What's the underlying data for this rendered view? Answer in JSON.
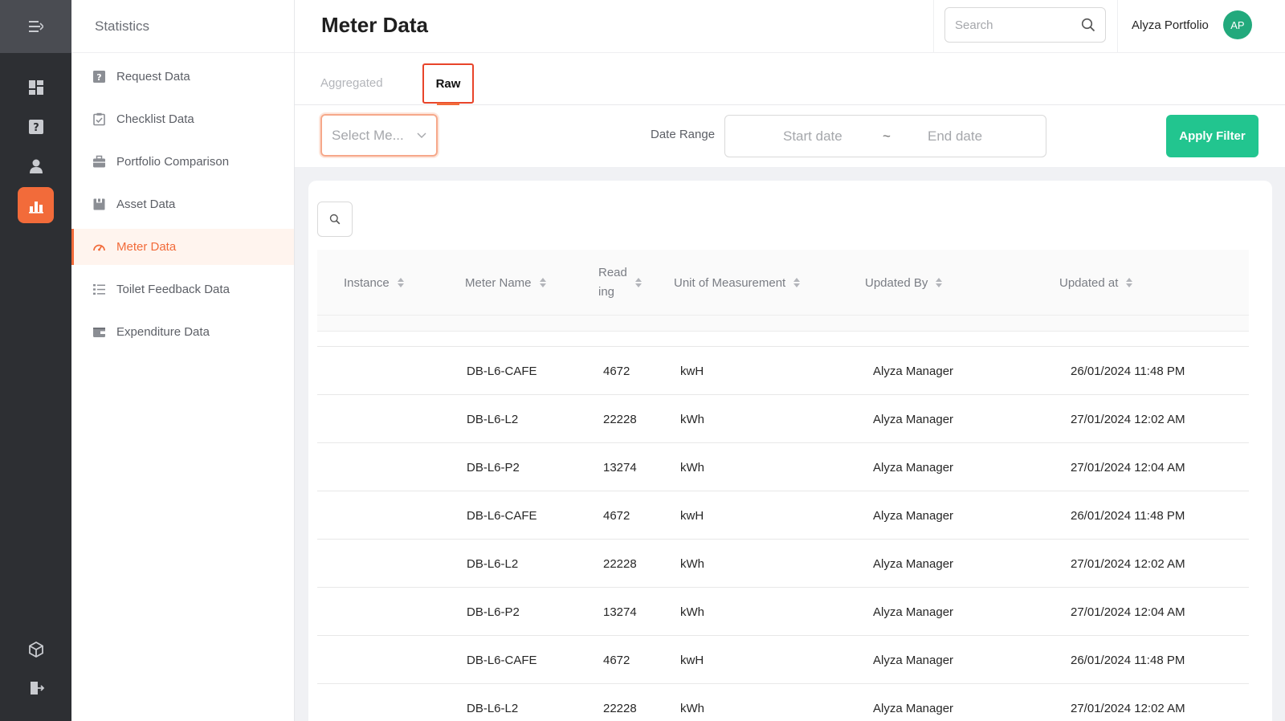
{
  "header": {
    "page_title": "Meter Data",
    "search_placeholder": "Search",
    "user_name": "Alyza Portfolio",
    "avatar_initials": "AP"
  },
  "sidebar": {
    "title": "Statistics",
    "items": [
      {
        "label": "Request Data",
        "icon": "question-square-icon"
      },
      {
        "label": "Checklist Data",
        "icon": "checklist-icon"
      },
      {
        "label": "Portfolio Comparison",
        "icon": "briefcase-icon"
      },
      {
        "label": "Asset Data",
        "icon": "asset-icon"
      },
      {
        "label": "Meter Data",
        "icon": "gauge-icon",
        "active": true
      },
      {
        "label": "Toilet Feedback Data",
        "icon": "list-icon"
      },
      {
        "label": "Expenditure Data",
        "icon": "wallet-icon"
      }
    ]
  },
  "tabs": {
    "aggregated": "Aggregated",
    "raw": "Raw",
    "active": "raw"
  },
  "filters": {
    "meter_select_placeholder": "Select Me...",
    "date_range_label": "Date Range",
    "start_placeholder": "Start date",
    "separator": "~",
    "end_placeholder": "End date",
    "apply_label": "Apply Filter"
  },
  "table": {
    "columns": [
      "Instance",
      "Meter Name",
      "Reading",
      "Unit of Measurement",
      "Updated By",
      "Updated at"
    ],
    "rows": [
      {
        "instance": "",
        "meter_name": "DB-L6-CAFE",
        "reading": "4672",
        "unit": "kwH",
        "updated_by": "Alyza Manager",
        "updated_at": "26/01/2024 11:48 PM"
      },
      {
        "instance": "",
        "meter_name": "DB-L6-L2",
        "reading": "22228",
        "unit": "kWh",
        "updated_by": "Alyza Manager",
        "updated_at": "27/01/2024 12:02 AM"
      },
      {
        "instance": "",
        "meter_name": "DB-L6-P2",
        "reading": "13274",
        "unit": "kWh",
        "updated_by": "Alyza Manager",
        "updated_at": "27/01/2024 12:04 AM"
      },
      {
        "instance": "",
        "meter_name": "DB-L6-CAFE",
        "reading": "4672",
        "unit": "kwH",
        "updated_by": "Alyza Manager",
        "updated_at": "26/01/2024 11:48 PM"
      },
      {
        "instance": "",
        "meter_name": "DB-L6-L2",
        "reading": "22228",
        "unit": "kWh",
        "updated_by": "Alyza Manager",
        "updated_at": "27/01/2024 12:02 AM"
      },
      {
        "instance": "",
        "meter_name": "DB-L6-P2",
        "reading": "13274",
        "unit": "kWh",
        "updated_by": "Alyza Manager",
        "updated_at": "27/01/2024 12:04 AM"
      },
      {
        "instance": "",
        "meter_name": "DB-L6-CAFE",
        "reading": "4672",
        "unit": "kwH",
        "updated_by": "Alyza Manager",
        "updated_at": "26/01/2024 11:48 PM"
      },
      {
        "instance": "",
        "meter_name": "DB-L6-L2",
        "reading": "22228",
        "unit": "kWh",
        "updated_by": "Alyza Manager",
        "updated_at": "27/01/2024 12:02 AM"
      }
    ]
  },
  "colors": {
    "accent": "#f26b3a",
    "apply_button": "#22c58f",
    "avatar": "#22a97c",
    "rail": "#2d2f33"
  }
}
